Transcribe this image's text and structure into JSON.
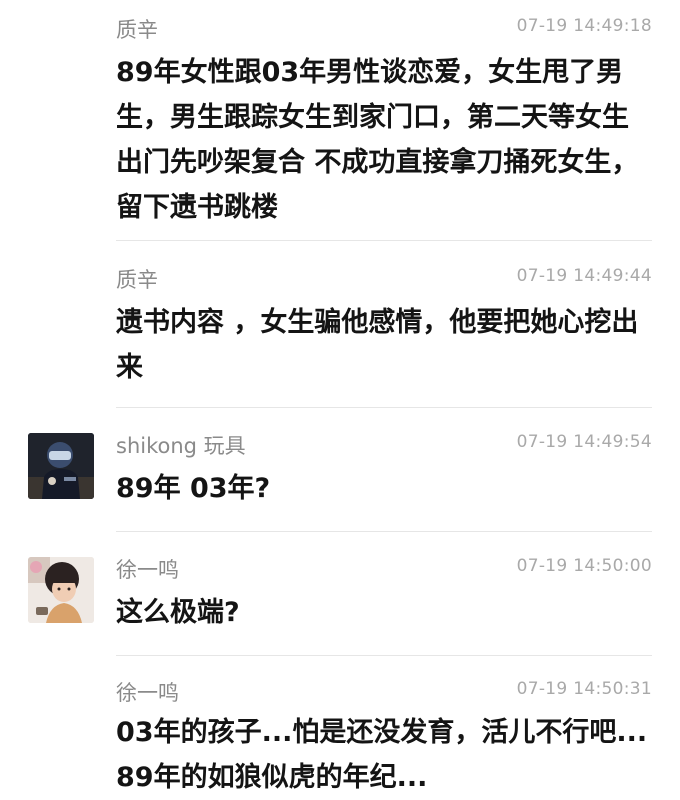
{
  "comments": [
    {
      "user": "质辛",
      "time": "07-19 14:49:18",
      "text": "89年女性跟03年男性谈恋爱，女生甩了男生，男生跟踪女生到家门口，第二天等女生出门先吵架复合 不成功直接拿刀捅死女生，留下遗书跳楼",
      "avatar": null
    },
    {
      "user": "质辛",
      "time": "07-19 14:49:44",
      "text": "遗书内容 ，女生骗他感情，他要把她心挖出来",
      "avatar": null
    },
    {
      "user": "shikong 玩具",
      "time": "07-19 14:49:54",
      "text": "89年 03年?",
      "avatar": "helmet-figure-avatar"
    },
    {
      "user": "徐一鸣",
      "time": "07-19 14:50:00",
      "text": "这么极端?",
      "avatar": "child-photo-avatar"
    },
    {
      "user": "徐一鸣",
      "time": "07-19 14:50:31",
      "text": "03年的孩子...怕是还没发育，活儿不行吧...89年的如狼似虎的年纪...",
      "avatar": null
    }
  ]
}
